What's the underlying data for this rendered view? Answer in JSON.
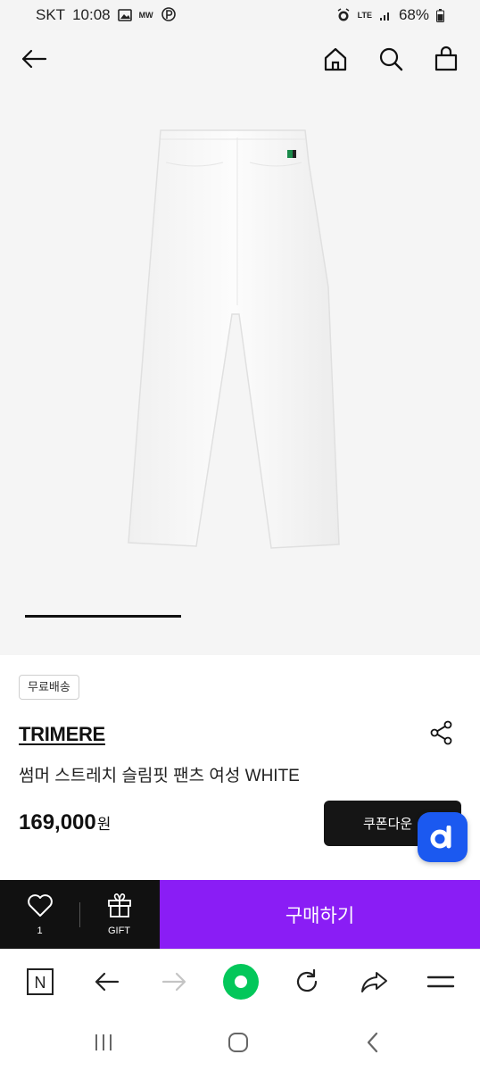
{
  "status_bar": {
    "carrier": "SKT",
    "time": "10:08",
    "network": "LTE",
    "battery": "68%",
    "icons": [
      "image-icon",
      "mw-icon",
      "p-icon",
      "alarm-icon",
      "lte-icon",
      "signal-icon",
      "battery-icon"
    ],
    "mw_text": "MW",
    "p_text": "P"
  },
  "top_nav": {
    "icons": [
      "back-arrow-icon",
      "home-icon",
      "search-icon",
      "shopping-bag-icon"
    ]
  },
  "product": {
    "badge": "무료배송",
    "brand": "TRIMERE",
    "name": "썸머 스트레치 슬림핏 팬츠 여성 WHITE",
    "price": "169,000",
    "price_unit": "원",
    "coupon_label": "쿠폰다운",
    "fab_label": "d",
    "image_icon": "white-pants-image"
  },
  "buy_bar": {
    "like_count": "1",
    "gift_label": "GIFT",
    "buy_label": "구매하기",
    "colors": {
      "dark": "#111111",
      "accent": "#8a1df5"
    }
  },
  "browser_bar": {
    "icons": [
      "naver-n-icon",
      "back-icon",
      "forward-icon",
      "green-circle-icon",
      "reload-icon",
      "share-icon",
      "menu-icon"
    ],
    "n_label": "N",
    "accent": "#03c75a"
  },
  "system_nav": {
    "icons": [
      "recent-apps-icon",
      "home-circle-icon",
      "back-chevron-icon"
    ]
  }
}
